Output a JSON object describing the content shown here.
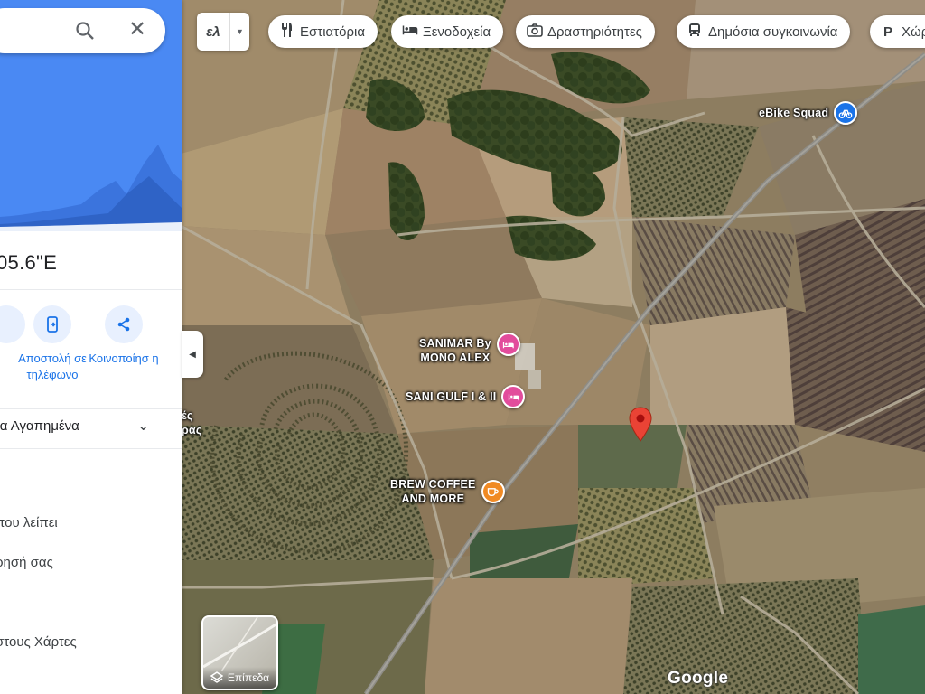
{
  "language": {
    "code": "ελ"
  },
  "chips": [
    {
      "label": "Εστιατόρια",
      "icon": "restaurant-icon"
    },
    {
      "label": "Ξενοδοχεία",
      "icon": "hotel-icon"
    },
    {
      "label": "Δραστηριότητες",
      "icon": "camera-icon"
    },
    {
      "label": "Δημόσια συγκοινωνία",
      "icon": "bus-icon"
    },
    {
      "label": "Χώρ",
      "icon": "parking-icon"
    }
  ],
  "panel": {
    "coords": "05.6\"E",
    "actions": [
      {
        "label": "Αποστολή σε τηλέφωνο",
        "icon": "send-to-phone-icon"
      },
      {
        "label": "Κοινοποίησ η",
        "icon": "share-icon"
      }
    ],
    "favorites": "τα Αγαπημένα",
    "links": [
      "που λείπει",
      "ρησή σας",
      "στους Χάρτες"
    ]
  },
  "map": {
    "pois": [
      {
        "lines": [
          "eBike Squad"
        ],
        "color": "#1a73e8",
        "kind": "bike"
      },
      {
        "lines": [
          "SANIMAR By",
          "MONO ALEX"
        ],
        "color": "#e24c9c",
        "kind": "hotel"
      },
      {
        "lines": [
          "SANI GULF I & II"
        ],
        "color": "#e24c9c",
        "kind": "hotel"
      },
      {
        "lines": [
          "BREW COFFEE",
          "AND MORE"
        ],
        "color": "#f08a24",
        "kind": "cafe"
      }
    ],
    "fragments": [
      "ές",
      "ρας"
    ]
  },
  "layers": {
    "label": "Επίπεδα"
  },
  "attribution": "Google",
  "colors": {
    "accent": "#1a73e8",
    "marker": "#ea4335",
    "hotel": "#e24c9c",
    "cafe": "#f08a24"
  }
}
